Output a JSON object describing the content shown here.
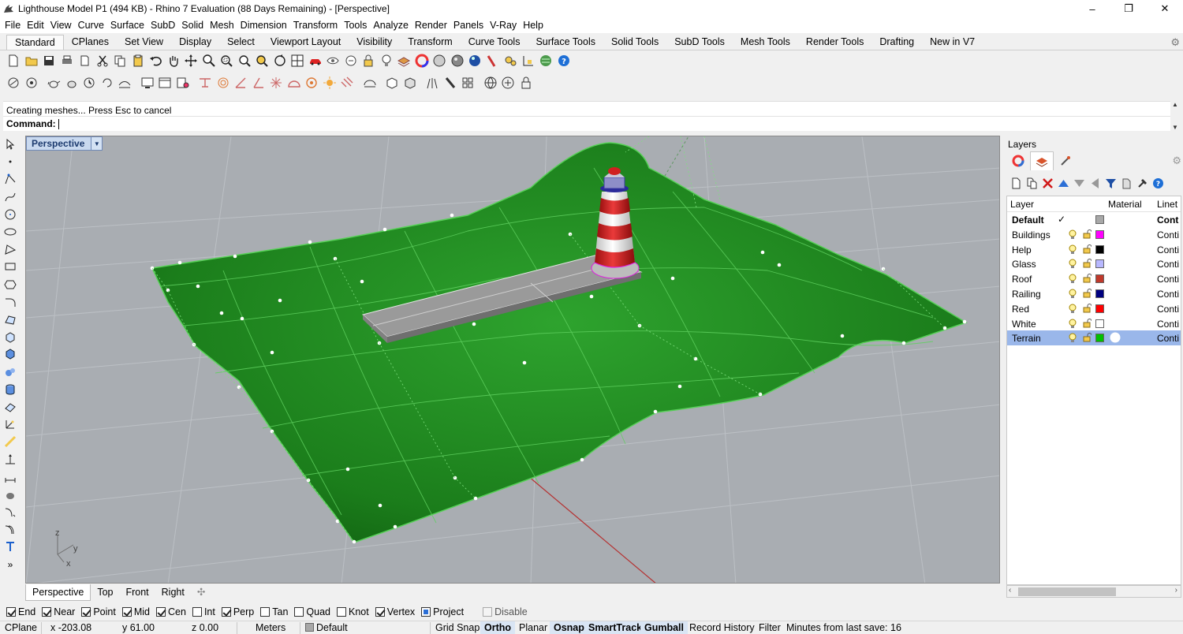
{
  "window": {
    "title": "Lighthouse Model P1 (494 KB) - Rhino 7 Evaluation (88 Days Remaining) - [Perspective]",
    "minimize": "–",
    "maximize": "❐",
    "close": "✕"
  },
  "menu": [
    "File",
    "Edit",
    "View",
    "Curve",
    "Surface",
    "SubD",
    "Solid",
    "Mesh",
    "Dimension",
    "Transform",
    "Tools",
    "Analyze",
    "Render",
    "Panels",
    "V-Ray",
    "Help"
  ],
  "tabs": [
    "Standard",
    "CPlanes",
    "Set View",
    "Display",
    "Select",
    "Viewport Layout",
    "Visibility",
    "Transform",
    "Curve Tools",
    "Surface Tools",
    "Solid Tools",
    "SubD Tools",
    "Mesh Tools",
    "Render Tools",
    "Drafting",
    "New in V7"
  ],
  "active_tab": "Standard",
  "command": {
    "history": "Creating meshes... Press Esc to cancel",
    "prompt": "Command:"
  },
  "viewport": {
    "name": "Perspective",
    "tabs": [
      "Perspective",
      "Top",
      "Front",
      "Right"
    ],
    "add_tab": "✣",
    "axis_labels": {
      "z": "z",
      "y": "y",
      "x": "x"
    },
    "terrain_color": "#1e8a1e",
    "background_color": "#a9adb2"
  },
  "layers": {
    "panel_title": "Layers",
    "columns": {
      "layer": "Layer",
      "material": "Material",
      "linetype": "Linet"
    },
    "rows": [
      {
        "name": "Default",
        "color": "#a8a8a8",
        "current": true,
        "current_mark": "✓",
        "linetype": "Cont"
      },
      {
        "name": "Buildings",
        "color": "#ff00ff",
        "linetype": "Conti"
      },
      {
        "name": "Help",
        "color": "#000000",
        "linetype": "Conti"
      },
      {
        "name": "Glass",
        "color": "#b8b8ff",
        "linetype": "Conti"
      },
      {
        "name": "Roof",
        "color": "#c0392b",
        "linetype": "Conti"
      },
      {
        "name": "Railing",
        "color": "#000080",
        "linetype": "Conti"
      },
      {
        "name": "Red",
        "color": "#ff0000",
        "linetype": "Conti"
      },
      {
        "name": "White",
        "color": "#ffffff",
        "linetype": "Conti"
      },
      {
        "name": "Terrain",
        "color": "#00c000",
        "linetype": "Conti",
        "selected": true
      }
    ]
  },
  "osnaps": [
    {
      "label": "End",
      "checked": true
    },
    {
      "label": "Near",
      "checked": true
    },
    {
      "label": "Point",
      "checked": true
    },
    {
      "label": "Mid",
      "checked": true
    },
    {
      "label": "Cen",
      "checked": true
    },
    {
      "label": "Int",
      "checked": false
    },
    {
      "label": "Perp",
      "checked": true
    },
    {
      "label": "Tan",
      "checked": false
    },
    {
      "label": "Quad",
      "checked": false
    },
    {
      "label": "Knot",
      "checked": false
    },
    {
      "label": "Vertex",
      "checked": true
    },
    {
      "label": "Project",
      "checked": true
    },
    {
      "label": "Disable",
      "checked": false
    }
  ],
  "status": {
    "cplane": "CPlane",
    "x": "x -203.08",
    "y": "y 61.00",
    "z": "z 0.00",
    "units": "Meters",
    "layer": "Default",
    "grid_snap": "Grid Snap",
    "ortho": "Ortho",
    "planar": "Planar",
    "osnap": "Osnap",
    "smarttrack": "SmartTrack",
    "gumball": "Gumball",
    "record_history": "Record History",
    "filter": "Filter",
    "save_info": "Minutes from last save: 16"
  }
}
